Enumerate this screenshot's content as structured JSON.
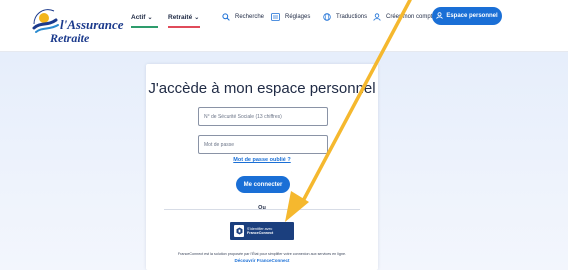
{
  "header": {
    "logo": {
      "line1": "l'Assurance",
      "line2": "Retraite",
      "arc_text": "SERVICE PUBLIC"
    },
    "nav": {
      "actif": "Actif",
      "retraite": "Retraité",
      "recherche": "Recherche",
      "reglages": "Réglages",
      "traductions": "Traductions",
      "creer_compte": "Créer mon compte",
      "espace_personnel": "Espace personnel"
    },
    "colors": {
      "actif_underline": "#2e9c6c",
      "retraite_underline": "#e04b5a",
      "primary": "#1a6fd6"
    }
  },
  "login": {
    "title": "J'accède à mon espace personnel",
    "secu_placeholder": "N° de Sécurité Sociale (13 chiffres)",
    "password_placeholder": "Mot de passe",
    "forgot_password": "Mot de passe oublié ?",
    "connect_button": "Me connecter",
    "separator": "Ou",
    "franceconnect": {
      "line1": "S'identifier avec",
      "line2": "FranceConnect",
      "note": "FranceConnect est la solution proposée par l'État pour simplifier votre connexion aux services en ligne.",
      "link": "Découvrir FranceConnect"
    }
  },
  "annotation": {
    "arrow_color": "#f5b82e"
  }
}
